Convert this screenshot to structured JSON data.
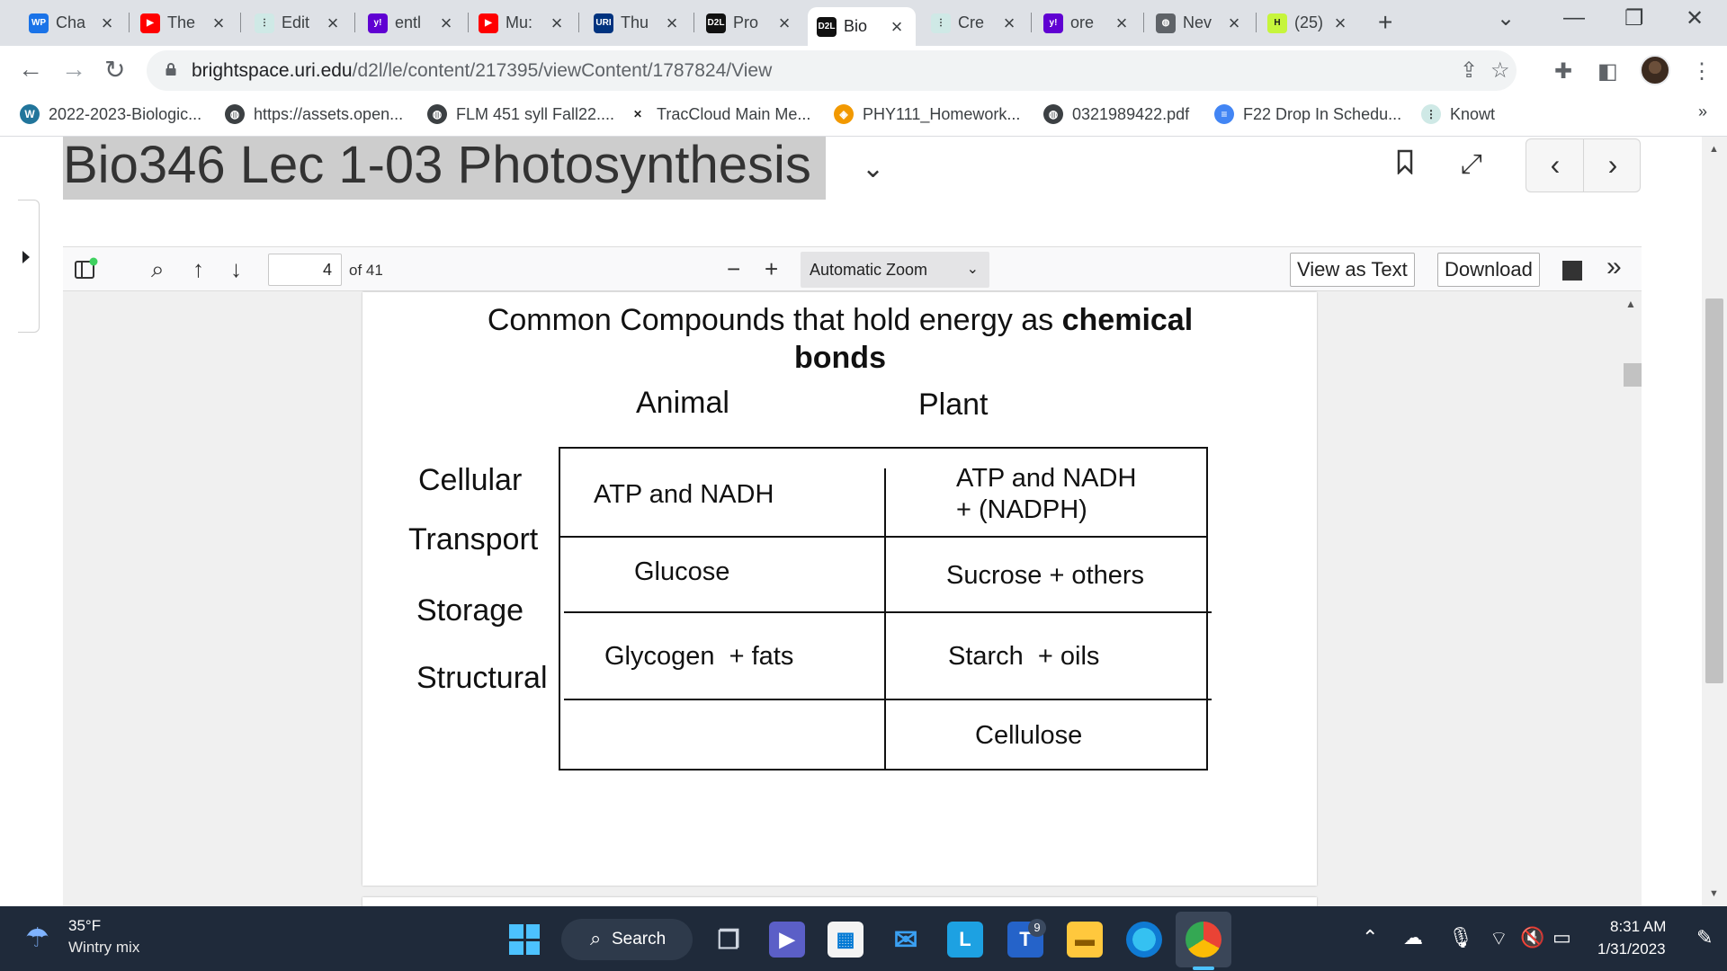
{
  "tabs": [
    {
      "label": "Cha",
      "icon": "wordpress-wp-icon",
      "color": "#1a73e8",
      "text": "WP"
    },
    {
      "label": "The",
      "icon": "youtube-icon",
      "color": "#ff0000",
      "text": "▶"
    },
    {
      "label": "Edit",
      "icon": "knowt-icon",
      "color": "#cfe9e6",
      "text": "⋮"
    },
    {
      "label": "entl",
      "icon": "yahoo-icon",
      "color": "#6001d2",
      "text": "y!"
    },
    {
      "label": "Mu:",
      "icon": "youtube-icon",
      "color": "#ff0000",
      "text": "▶"
    },
    {
      "label": "Thu",
      "icon": "uri-icon",
      "color": "#00337f",
      "text": "URI"
    },
    {
      "label": "Pro",
      "icon": "d2l-icon",
      "color": "#111111",
      "text": "D2L"
    },
    {
      "label": "Bio",
      "icon": "d2l-icon",
      "color": "#111111",
      "text": "D2L",
      "active": true
    },
    {
      "label": "Cre",
      "icon": "knowt-icon",
      "color": "#cfe9e6",
      "text": "⋮"
    },
    {
      "label": "ore",
      "icon": "yahoo-icon",
      "color": "#6001d2",
      "text": "y!"
    },
    {
      "label": "Nev",
      "icon": "globe-icon",
      "color": "#5f6368",
      "text": "◍"
    },
    {
      "label": "(25)",
      "icon": "hypothesis-icon",
      "color": "#c6f53c",
      "text": "H"
    }
  ],
  "url": {
    "host": "brightspace.uri.edu",
    "path": "/d2l/le/content/217395/viewContent/1787824/View"
  },
  "bookmarks": [
    {
      "label": "2022-2023-Biologic...",
      "icon": "wordpress-icon",
      "color": "#21759b",
      "text": "W"
    },
    {
      "label": "https://assets.open...",
      "icon": "globe-icon",
      "color": "#3c4043",
      "text": "◍"
    },
    {
      "label": "FLM 451 syll Fall22....",
      "icon": "globe-icon",
      "color": "#3c4043",
      "text": "◍"
    },
    {
      "label": "TracCloud Main Me...",
      "icon": "traccloud-icon",
      "color": "#ffffff",
      "text": "✕"
    },
    {
      "label": "PHY111_Homework...",
      "icon": "webassign-icon",
      "color": "#f29900",
      "text": "◈"
    },
    {
      "label": "0321989422.pdf",
      "icon": "globe-icon",
      "color": "#3c4043",
      "text": "◍"
    },
    {
      "label": "F22 Drop In Schedu...",
      "icon": "google-docs-icon",
      "color": "#4285f4",
      "text": "≡"
    },
    {
      "label": "Knowt",
      "icon": "knowt-icon",
      "color": "#cfe9e6",
      "text": "⋮"
    }
  ],
  "bookmarks_more": "»",
  "document": {
    "title": "Bio346 Lec 1-03 Photosynthesis"
  },
  "pdf": {
    "page": "4",
    "of_pages": "of 41",
    "zoom": "Automatic Zoom",
    "view_as_text": "View as Text",
    "download": "Download"
  },
  "slide": {
    "title_pre": "Common Compounds that hold energy as ",
    "title_bold": "chemical bonds",
    "columns": [
      "Animal",
      "Plant"
    ],
    "rows": [
      {
        "label": "Cellular",
        "animal": "ATP and NADH",
        "plant": "ATP and NADH + (NADPH)"
      },
      {
        "label": "Transport",
        "animal": "Glucose",
        "plant": "Sucrose + others"
      },
      {
        "label": "Storage",
        "animal": "Glycogen  + fats",
        "plant": "Starch  + oils"
      },
      {
        "label": "Structural",
        "animal": "",
        "plant": "Cellulose"
      }
    ]
  },
  "taskbar": {
    "weather_temp": "35°F",
    "weather_desc": "Wintry mix",
    "search": "Search",
    "teams_badge": "9",
    "time": "8:31 AM",
    "date": "1/31/2023"
  }
}
